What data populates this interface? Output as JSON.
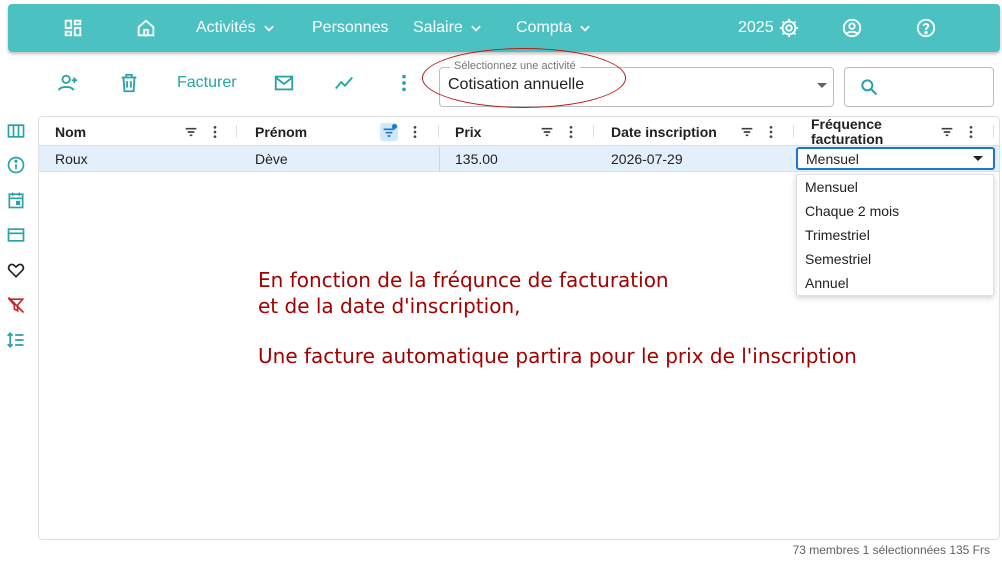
{
  "nav": {
    "activites": "Activités",
    "personnes": "Personnes",
    "salaire": "Salaire",
    "compta": "Compta",
    "year": "2025"
  },
  "toolbar": {
    "facturer": "Facturer"
  },
  "activity_select": {
    "legend": "Sélectionnez une activité",
    "value": "Cotisation annuelle"
  },
  "grid": {
    "columns": {
      "nom": "Nom",
      "prenom": "Prénom",
      "prix": "Prix",
      "date": "Date inscription",
      "freq_line1": "Fréquence",
      "freq_line2": "facturation"
    },
    "row": {
      "nom": "Roux",
      "prenom": "Dève",
      "prix": "135.00",
      "date": "2026-07-29",
      "frequence": "Mensuel"
    }
  },
  "dropdown_options": [
    "Mensuel",
    "Chaque 2 mois",
    "Trimestriel",
    "Semestriel",
    "Annuel"
  ],
  "annotation": {
    "line1": "En fonction de la fréqunce de facturation",
    "line2": "et de la date d'inscription,",
    "line3": "Une facture automatique partira pour le prix de l'inscription"
  },
  "footer": "73 membres 1 sélectionnées 135 Frs",
  "colors": {
    "accent": "#4bc1c1",
    "icon": "#27a2a6",
    "annotation": "#a30000"
  }
}
